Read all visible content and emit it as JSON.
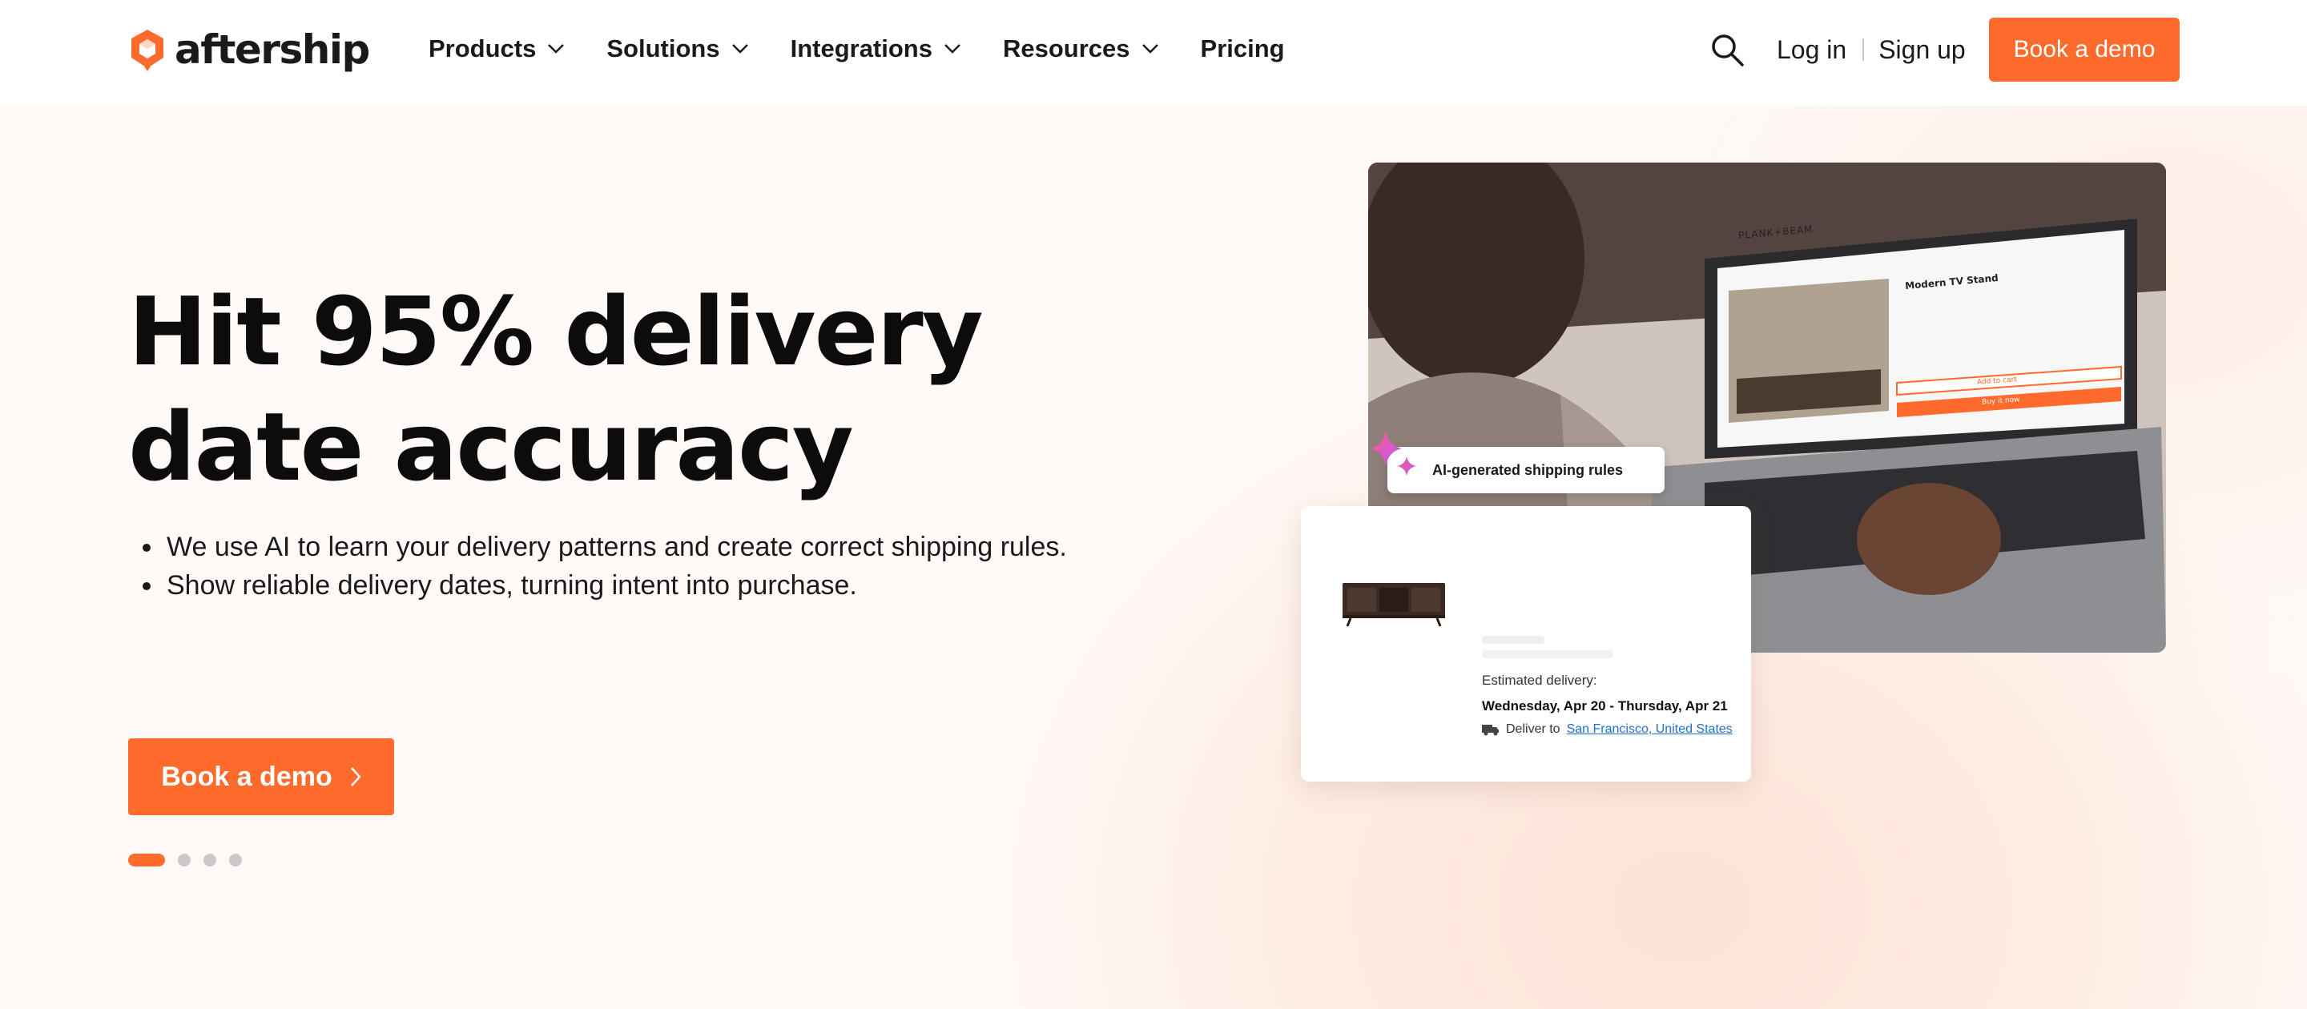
{
  "header": {
    "logo_text": "aftership",
    "nav": [
      {
        "label": "Products",
        "has_dropdown": true
      },
      {
        "label": "Solutions",
        "has_dropdown": true
      },
      {
        "label": "Integrations",
        "has_dropdown": true
      },
      {
        "label": "Resources",
        "has_dropdown": true
      },
      {
        "label": "Pricing",
        "has_dropdown": false
      }
    ],
    "search_icon": "search-icon",
    "login_label": "Log in",
    "signup_label": "Sign up",
    "cta_label": "Book a demo"
  },
  "hero": {
    "title_line1": "Hit 95% delivery",
    "title_line2": "date accuracy",
    "bullets": [
      "We use AI to learn your delivery patterns and create correct shipping rules.",
      "Show reliable delivery dates, turning intent into purchase."
    ],
    "cta_label": "Book a demo",
    "carousel": {
      "total": 4,
      "active": 1
    }
  },
  "showcase": {
    "ai_pill_label": "AI-generated shipping rules",
    "laptop_brand": "PLANK+BEAM",
    "laptop_product": "Modern TV Stand",
    "laptop_add_to_cart": "Add to cart",
    "laptop_buy_now": "Buy it now",
    "card": {
      "estimated_label": "Estimated delivery:",
      "date_range": "Wednesday, Apr 20 - Thursday, Apr 21",
      "deliver_to_label": "Deliver to",
      "location": "San Francisco, United States"
    }
  },
  "colors": {
    "accent": "#ff6b2c",
    "text": "#111111",
    "link": "#1e6fd0"
  }
}
